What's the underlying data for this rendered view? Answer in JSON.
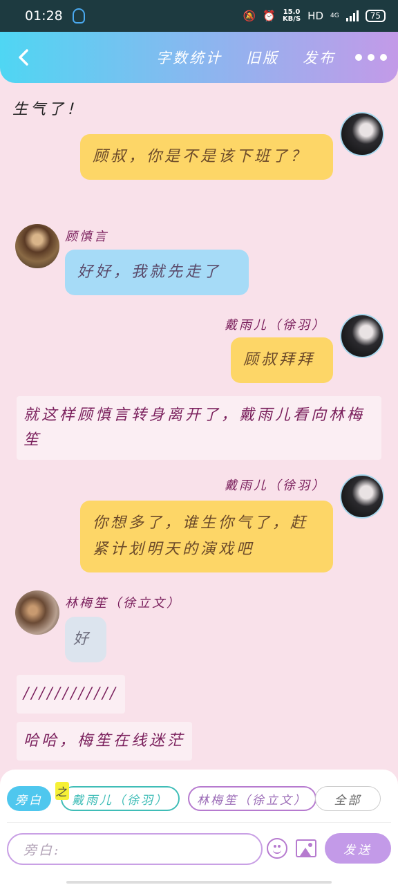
{
  "status_bar": {
    "time": "01:28",
    "speed_value": "15.0",
    "speed_unit": "KB/S",
    "network": "HD",
    "signal": "4G",
    "battery": "75"
  },
  "header": {
    "back_icon": "chevron-left-icon",
    "nav": [
      "字数统计",
      "旧版",
      "发布"
    ],
    "more_icon": "more-dots-icon"
  },
  "chat": {
    "narration_top": "生气了！",
    "messages": [
      {
        "type": "right",
        "text": "顾叔，你是不是该下班了？"
      },
      {
        "type": "left",
        "name": "顾慎言",
        "text": "好好，我就先走了"
      },
      {
        "type": "right",
        "name": "戴雨儿（徐羽）",
        "text": "顾叔拜拜"
      },
      {
        "type": "narration",
        "text": "就这样顾慎言转身离开了，戴雨儿看向林梅笙"
      },
      {
        "type": "right",
        "name": "戴雨儿（徐羽）",
        "text": "你想多了，谁生你气了，赶紧计划明天的演戏吧"
      },
      {
        "type": "left",
        "name": "林梅笙（徐立文）",
        "text": "好"
      },
      {
        "type": "narration",
        "text": "////////////"
      },
      {
        "type": "narration",
        "text": "哈哈，梅笙在线迷茫"
      }
    ]
  },
  "composer": {
    "chips": {
      "aside": "旁白",
      "highlight": "之",
      "dai": "戴雨儿（徐羽）",
      "lin": "林梅笙（徐立文）",
      "all": "全部"
    },
    "input_placeholder": "旁白:",
    "send": "发送",
    "emoji_icon": "smiley-icon",
    "image_icon": "image-icon"
  },
  "colors": {
    "accent": "#c39ae8",
    "header_start": "#4fd6f3",
    "background": "#f9e1ea",
    "yellow_bubble": "#fdd667",
    "blue_bubble": "#a6dbf7",
    "narration_text": "#7a1f5c"
  }
}
